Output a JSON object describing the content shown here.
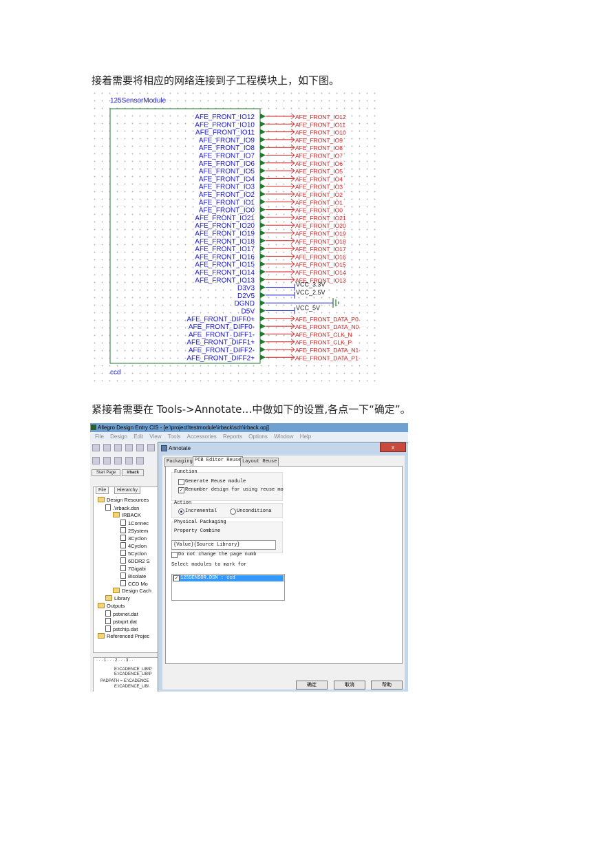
{
  "paragraphs": {
    "intro": "接着需要将相应的网络连接到子工程模块上，如下图。",
    "annotate_intro": "紧接着需要在 Tools->Annotate…中做如下的设置,各点一下“确定”。"
  },
  "schematic": {
    "module_name": "125SensorModule",
    "footer_label": "ccd",
    "ports": [
      {
        "pin": "AFE_FRONT_IO12",
        "net": "AFE_FRONT_IO12",
        "kind": "offpage"
      },
      {
        "pin": "AFE_FRONT_IO10",
        "net": "AFE_FRONT_IO11",
        "kind": "offpage"
      },
      {
        "pin": "AFE_FRONT_IO11",
        "net": "AFE_FRONT_IO10",
        "kind": "offpage"
      },
      {
        "pin": "AFE_FRONT_IO9",
        "net": "AFE_FRONT_IO9",
        "kind": "offpage"
      },
      {
        "pin": "AFE_FRONT_IO8",
        "net": "AFE_FRONT_IO8",
        "kind": "offpage"
      },
      {
        "pin": "AFE_FRONT_IO7",
        "net": "AFE_FRONT_IO7",
        "kind": "offpage"
      },
      {
        "pin": "AFE_FRONT_IO6",
        "net": "AFE_FRONT_IO6",
        "kind": "offpage"
      },
      {
        "pin": "AFE_FRONT_IO5",
        "net": "AFE_FRONT_IO5",
        "kind": "offpage"
      },
      {
        "pin": "AFE_FRONT_IO4",
        "net": "AFE_FRONT_IO4",
        "kind": "offpage"
      },
      {
        "pin": "AFE_FRONT_IO3",
        "net": "AFE_FRONT_IO3",
        "kind": "offpage"
      },
      {
        "pin": "AFE_FRONT_IO2",
        "net": "AFE_FRONT_IO2",
        "kind": "offpage"
      },
      {
        "pin": "AFE_FRONT_IO1",
        "net": "AFE_FRONT_IO1",
        "kind": "offpage"
      },
      {
        "pin": "AFE_FRONT_IO0",
        "net": "AFE_FRONT_IO0",
        "kind": "offpage"
      },
      {
        "pin": "AFE_FRONT_IO21",
        "net": "AFE_FRONT_IO21",
        "kind": "offpage"
      },
      {
        "pin": "AFE_FRONT_IO20",
        "net": "AFE_FRONT_IO20",
        "kind": "offpage"
      },
      {
        "pin": "AFE_FRONT_IO19",
        "net": "AFE_FRONT_IO19",
        "kind": "offpage"
      },
      {
        "pin": "AFE_FRONT_IO18",
        "net": "AFE_FRONT_IO18",
        "kind": "offpage"
      },
      {
        "pin": "AFE_FRONT_IO17",
        "net": "AFE_FRONT_IO17",
        "kind": "offpage"
      },
      {
        "pin": "AFE_FRONT_IO16",
        "net": "AFE_FRONT_IO16",
        "kind": "offpage"
      },
      {
        "pin": "AFE_FRONT_IO15",
        "net": "AFE_FRONT_IO15",
        "kind": "offpage"
      },
      {
        "pin": "AFE_FRONT_IO14",
        "net": "AFE_FRONT_IO14",
        "kind": "offpage"
      },
      {
        "pin": "AFE_FRONT_IO13",
        "net": "AFE_FRONT_IO13",
        "kind": "offpage"
      },
      {
        "pin": "D3V3",
        "net": "VCC_3.3V",
        "kind": "power"
      },
      {
        "pin": "D2V5",
        "net": "VCC_2.5V",
        "kind": "power"
      },
      {
        "pin": "DGND",
        "net": "",
        "kind": "ground"
      },
      {
        "pin": "D5V",
        "net": "VCC_5V",
        "kind": "power"
      },
      {
        "pin": "AFE_FRONT_DIFF0+",
        "net": "AFE_FRONT_DATA_P0",
        "kind": "offpage"
      },
      {
        "pin": "AFE_FRONT_DIFF0-",
        "net": "AFE_FRONT_DATA_N0",
        "kind": "offpage"
      },
      {
        "pin": "AFE_FRONT_DIFF1-",
        "net": "AFE_FRONT_CLK_N",
        "kind": "offpage"
      },
      {
        "pin": "AFE_FRONT_DIFF1+",
        "net": "AFE_FRONT_CLK_P",
        "kind": "offpage"
      },
      {
        "pin": "AFE_FRONT_DIFF2-",
        "net": "AFE_FRONT_DATA_N1",
        "kind": "offpage"
      },
      {
        "pin": "AFE_FRONT_DIFF2+",
        "net": "AFE_FRONT_DATA_P1",
        "kind": "offpage"
      }
    ],
    "colors": {
      "pin_text": "#1a1ad6",
      "net_text": "#d61a1a",
      "pin_arrow": "#1e7a2e",
      "wire": "#d61a1a",
      "power_wire": "#1a1ad6",
      "ground": "#1e7a2e"
    }
  },
  "screenshot": {
    "window_title": "Allegro Design Entry CIS - [e:\\project\\testmodule\\irback\\sch\\irback.opj]",
    "menu": [
      "File",
      "Design",
      "Edit",
      "View",
      "Tools",
      "Accessories",
      "Reports",
      "Options",
      "Window",
      "Help"
    ],
    "left_tabs": [
      "Start Page",
      "irback"
    ],
    "panel_tabs": [
      "File",
      "Hierarchy"
    ],
    "tree": [
      {
        "label": "Design Resources",
        "depth": 0,
        "icon": "folder"
      },
      {
        "label": ".\\irback.dsn",
        "depth": 1,
        "icon": "file"
      },
      {
        "label": "IRBACK",
        "depth": 2,
        "icon": "folder"
      },
      {
        "label": "1Connec",
        "depth": 3,
        "icon": "file"
      },
      {
        "label": "2System",
        "depth": 3,
        "icon": "file"
      },
      {
        "label": "3Cyclon",
        "depth": 3,
        "icon": "file"
      },
      {
        "label": "4Cyclon",
        "depth": 3,
        "icon": "file"
      },
      {
        "label": "5Cyclon",
        "depth": 3,
        "icon": "file"
      },
      {
        "label": "6DDR2 S",
        "depth": 3,
        "icon": "file"
      },
      {
        "label": "7Gigabi",
        "depth": 3,
        "icon": "file"
      },
      {
        "label": "8Isolate",
        "depth": 3,
        "icon": "file"
      },
      {
        "label": "CCD Mo",
        "depth": 3,
        "icon": "file"
      },
      {
        "label": "Design Cach",
        "depth": 2,
        "icon": "folder"
      },
      {
        "label": "Library",
        "depth": 1,
        "icon": "folder"
      },
      {
        "label": "Outputs",
        "depth": 0,
        "icon": "folder"
      },
      {
        "label": "pstxnet.dat",
        "depth": 1,
        "icon": "file"
      },
      {
        "label": "pstxprt.dat",
        "depth": 1,
        "icon": "file"
      },
      {
        "label": "pstchip.dat",
        "depth": 1,
        "icon": "file"
      },
      {
        "label": "Referenced Projec",
        "depth": 0,
        "icon": "folder"
      }
    ],
    "session_ruler": "· · · 1 · · · 2 · · · 3 · ·",
    "session_lines": [
      "E:\\CADENCE_LIB\\P",
      "E:\\CADENCE_LIB\\P",
      "PADPATH = E:\\CADENCE",
      "E:\\CADENCE_LIB\\"
    ],
    "dialog": {
      "title": "Annotate",
      "close": "x",
      "tabs": [
        "Packaging",
        "PCB Editor Reuse",
        "Layout Reuse"
      ],
      "function_label": "Function",
      "generate_reuse": "Generate Reuse module",
      "generate_reuse_checked": false,
      "renumber": "Renumber design for using reuse mo",
      "renumber_checked": true,
      "action_label": "Action",
      "incremental": "Incremental",
      "unconditional": "Unconditiona",
      "action_selected": "Incremental",
      "physical_packaging": "Physical Packaging",
      "property_combine_label": "Property Combine",
      "property_combine_value": "{Value}{Source Library}",
      "no_change_page": "Do not change the page numb",
      "no_change_checked": false,
      "select_modules_label": "Select modules to mark for",
      "module_item": "125SENSOR.DSN : ccd",
      "module_checked": true,
      "ok": "确定",
      "cancel": "取消",
      "help": "帮助"
    }
  }
}
